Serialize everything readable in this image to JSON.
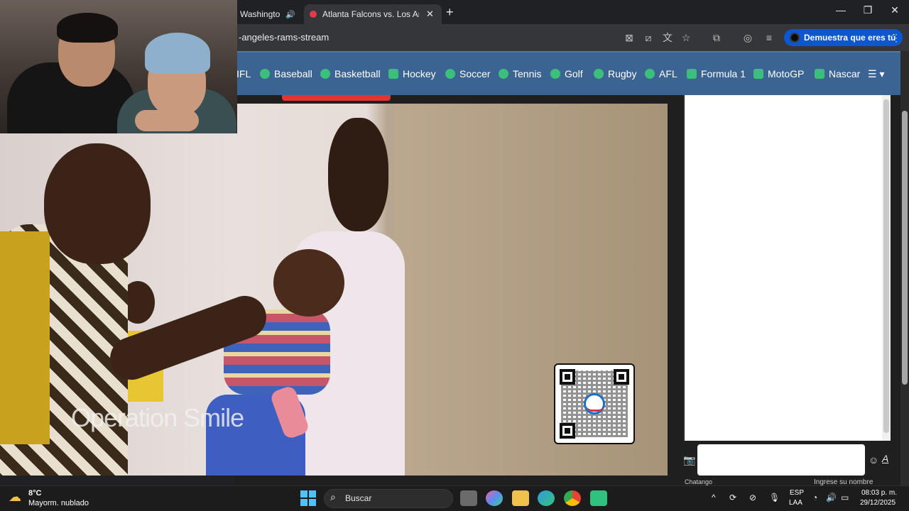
{
  "browser": {
    "tabs": [
      {
        "label": "Washingto",
        "close": "✕"
      },
      {
        "label": "Atlanta Falcons vs. Los Angeles",
        "close": "✕"
      }
    ],
    "new_tab": "+",
    "url": "-angeles-rams-stream",
    "verify_button": "Demuestra que eres tú",
    "window_controls": {
      "minimize": "—",
      "maximize": "❐",
      "close": "✕"
    }
  },
  "site_nav": {
    "items": [
      "IFL",
      "Baseball",
      "Basketball",
      "Hockey",
      "Soccer",
      "Tennis",
      "Golf",
      "Rugby",
      "AFL",
      "Formula 1",
      "MotoGP",
      "Nascar"
    ],
    "menu_icon": "☰ ▾"
  },
  "video": {
    "watermark": "Operation Smile"
  },
  "chat": {
    "brand": "Chatango",
    "login_hint": "Ingrese su nombre",
    "camera_icon": "📷",
    "emoji_icon": "☺",
    "font_icon": "A"
  },
  "taskbar": {
    "weather_temp": "8°C",
    "weather_desc": "Mayorm. nublado",
    "search_placeholder": "Buscar",
    "lang_line1": "ESP",
    "lang_line2": "LAA",
    "time": "08:03 p. m.",
    "date": "29/12/2025"
  }
}
